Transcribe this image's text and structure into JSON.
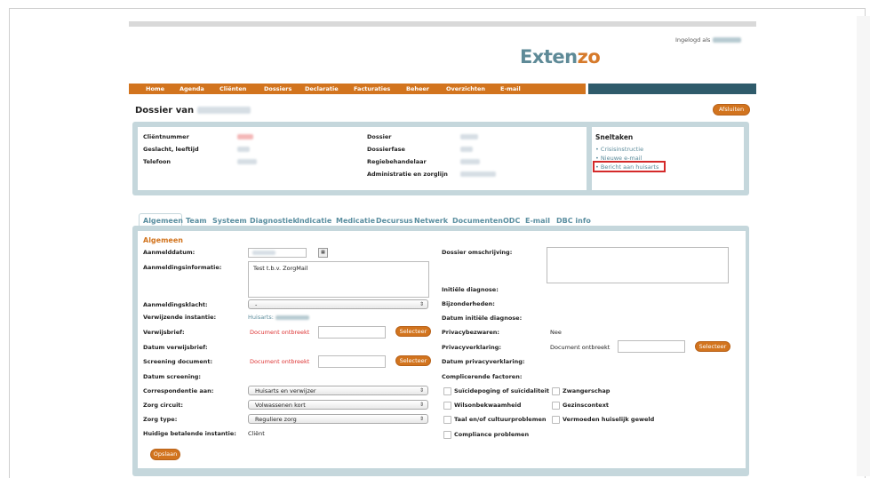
{
  "header": {
    "logo_main": "Exten",
    "logo_accent": "zo",
    "logged_in_label": "Ingelogd als"
  },
  "nav": {
    "items": [
      "Home",
      "Agenda",
      "Cliënten",
      "Dossiers",
      "Declaratie",
      "Facturaties",
      "Beheer",
      "Overzichten",
      "E-mail"
    ]
  },
  "page": {
    "title": "Dossier van",
    "close_button": "Afsluiten"
  },
  "client_info": {
    "left": [
      {
        "label": "Cliëntnummer"
      },
      {
        "label": "Geslacht, leeftijd"
      },
      {
        "label": "Telefoon"
      }
    ],
    "middle": [
      {
        "label": "Dossier"
      },
      {
        "label": "Dossierfase"
      },
      {
        "label": "Regiebehandelaar"
      },
      {
        "label": "Administratie en zorglijn"
      }
    ]
  },
  "sneltaken": {
    "title": "Sneltaken",
    "items": [
      "Crisisinstructie",
      "Nieuwe e-mail",
      "Bericht aan huisarts"
    ]
  },
  "tabs": [
    "Algemeen",
    "Team",
    "Systeem",
    "Diagnostiek",
    "Indicatie",
    "Medicatie",
    "Decursus",
    "Netwerk",
    "Documenten",
    "ODC",
    "E-mail",
    "DBC info"
  ],
  "form": {
    "section_title": "Algemeen",
    "aanmelddatum": "Aanmelddatum:",
    "aanmeldingsinformatie": "Aanmeldingsinformatie:",
    "aanmeldingsinformatie_value": "Test t.b.v. ZorgMail",
    "aanmeldingsklacht": "Aanmeldingsklacht:",
    "aanmeldingsklacht_value": "-",
    "verwijzende_instantie": "Verwijzende instantie:",
    "verwijzende_instantie_value": "Huisarts:",
    "verwijsbrief": "Verwijsbrief:",
    "document_ontbreekt": "Document ontbreekt",
    "selecteer": "Selecteer",
    "datum_verwijsbrief": "Datum verwijsbrief:",
    "screening_document": "Screening document:",
    "datum_screening": "Datum screening:",
    "correspondentie": "Correspondentie aan:",
    "correspondentie_value": "Huisarts en verwijzer",
    "zorg_circuit": "Zorg circuit:",
    "zorg_circuit_value": "Volwassenen kort",
    "zorg_type": "Zorg type:",
    "zorg_type_value": "Reguliere zorg",
    "huidige_betalende": "Huidige betalende instantie:",
    "huidige_betalende_value": "Cliënt",
    "save": "Opslaan",
    "dossier_omschrijving": "Dossier omschrijving:",
    "initiele_diagnose": "Initiële diagnose:",
    "bijzonderheden": "Bijzonderheden:",
    "datum_initiele_diagnose": "Datum initiële diagnose:",
    "privacybezwaren": "Privacybezwaren:",
    "privacybezwaren_value": "Nee",
    "privacyverklaring": "Privacyverklaring:",
    "privacy_document": "Document ontbreekt",
    "datum_privacyverklaring": "Datum privacyverklaring:",
    "complicerende_factoren": "Complicerende factoren:",
    "checks": [
      "Suïcidepoging of suïcidaliteit",
      "Zwangerschap",
      "Wilsonbekwaamheid",
      "Gezinscontext",
      "Taal en/of cultuurproblemen",
      "Vermoeden huiselijk geweld",
      "Compliance problemen"
    ]
  },
  "colors": {
    "orange": "#d2741e",
    "teal": "#2f5b6b",
    "highlight": "#d42a2a"
  }
}
